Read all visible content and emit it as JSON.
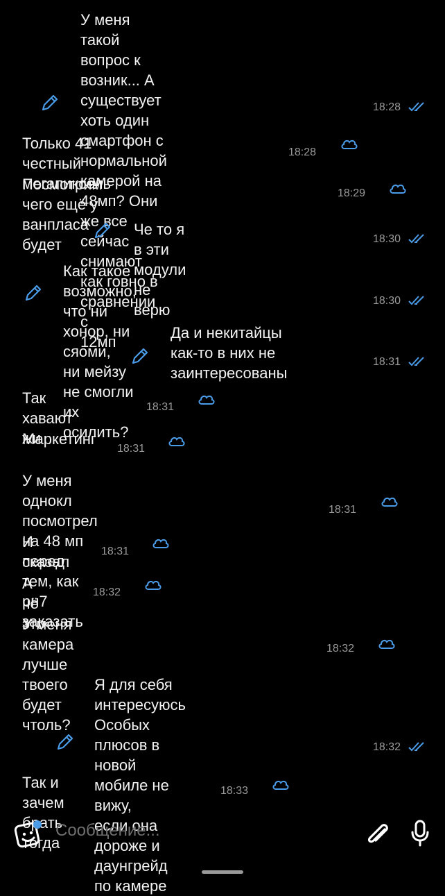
{
  "colors": {
    "background": "#000000",
    "accent": "#4a9ce8",
    "text": "#f2f2f2",
    "time": "#9a9a9a"
  },
  "messages": [
    {
      "text": "У меня такой вопрос к возник... А\nсуществует хоть один смартфон с\nнормальной камерой на 48мп? Они же все\nсейчас снимают как говно в сравнении с\n12мп",
      "time": "18:28",
      "outgoing": true
    },
    {
      "text": "Только 41 честный мегапиксель",
      "time": "18:28",
      "outgoing": false
    },
    {
      "text": "Посмотрим чего ещё у ванпласа будет",
      "time": "18:29",
      "outgoing": false
    },
    {
      "text": "Че то я в эти модули не верю",
      "time": "18:30",
      "outgoing": true
    },
    {
      "text": "Как такое возможно, что ни хонор, ни сяоми,\nни мейзу не смогли их осилить?",
      "time": "18:30",
      "outgoing": true
    },
    {
      "text": "Да и некитайцы как-то в них не\nзаинтересованы",
      "time": "18:31",
      "outgoing": true
    },
    {
      "text": "Так хавают жи",
      "time": "18:31",
      "outgoing": false
    },
    {
      "text": "Маркетинг",
      "time": "18:31",
      "outgoing": false
    },
    {
      "text": "У меня однокл посмотрел на 48 мп перед\nтем, как рн7 заказать",
      "time": "18:31",
      "outgoing": false
    },
    {
      "text": "И сказал",
      "time": "18:31",
      "outgoing": false
    },
    {
      "text": "А чё это",
      "time": "18:32",
      "outgoing": false
    },
    {
      "text": "У меня камера лучше твоего будет чтоль?",
      "time": "18:32",
      "outgoing": false
    },
    {
      "text": "Я для себя интересуюсь\nОсобых плюсов в новой мобиле не вижу,\nесли она дороже и даунгрейд по камере",
      "time": "18:32",
      "outgoing": true
    },
    {
      "text": "Так и зачем брать тогда",
      "time": "18:33",
      "outgoing": false
    }
  ],
  "composer": {
    "placeholder": "Сообщение...",
    "sticker_icon": "sticker-icon",
    "attach_icon": "paperclip-icon",
    "mic_icon": "microphone-icon"
  },
  "icons": {
    "edit": "pencil-icon",
    "read": "double-check-icon",
    "cloud": "cloud-icon"
  }
}
